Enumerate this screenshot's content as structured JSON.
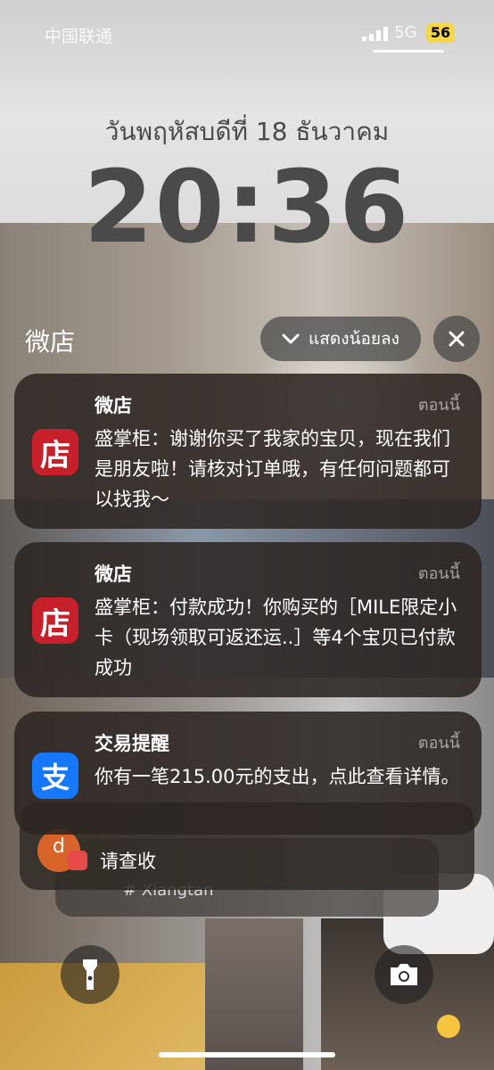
{
  "status_bar": {
    "carrier": "中国联通",
    "network": "5G",
    "battery": "56"
  },
  "lock_screen": {
    "date": "วันพฤหัสบดีที่ 18 ธันวาคม",
    "time": "20:36"
  },
  "group": {
    "title": "微店",
    "show_less_label": "แสดงน้อยลง"
  },
  "notifications": [
    {
      "app": "微店",
      "time": "ตอนนี้",
      "body": "盛掌柜：谢谢你买了我家的宝贝，现在我们是朋友啦！请核对订单哦，有任何问题都可以找我～",
      "icon": "shop-icon",
      "icon_char": "店",
      "icon_color": "#c8202a"
    },
    {
      "app": "微店",
      "time": "ตอนนี้",
      "body": "盛掌柜：付款成功！你购买的［MILE限定小卡（现场领取可返还运..］等4个宝贝已付款成功",
      "icon": "shop-icon",
      "icon_char": "店",
      "icon_color": "#c8202a"
    },
    {
      "app": "交易提醒",
      "time": "ตอนนี้",
      "body": "你有一笔215.00元的支出，点此查看详情。",
      "icon": "alipay-icon",
      "icon_char": "支",
      "icon_color": "#1677ff"
    }
  ],
  "stacked_notification": {
    "body": "请查收",
    "sub_text": "# Xiangtan",
    "icon_letter": "d"
  },
  "controls": {
    "flashlight": "flashlight-icon",
    "camera": "camera-icon"
  }
}
